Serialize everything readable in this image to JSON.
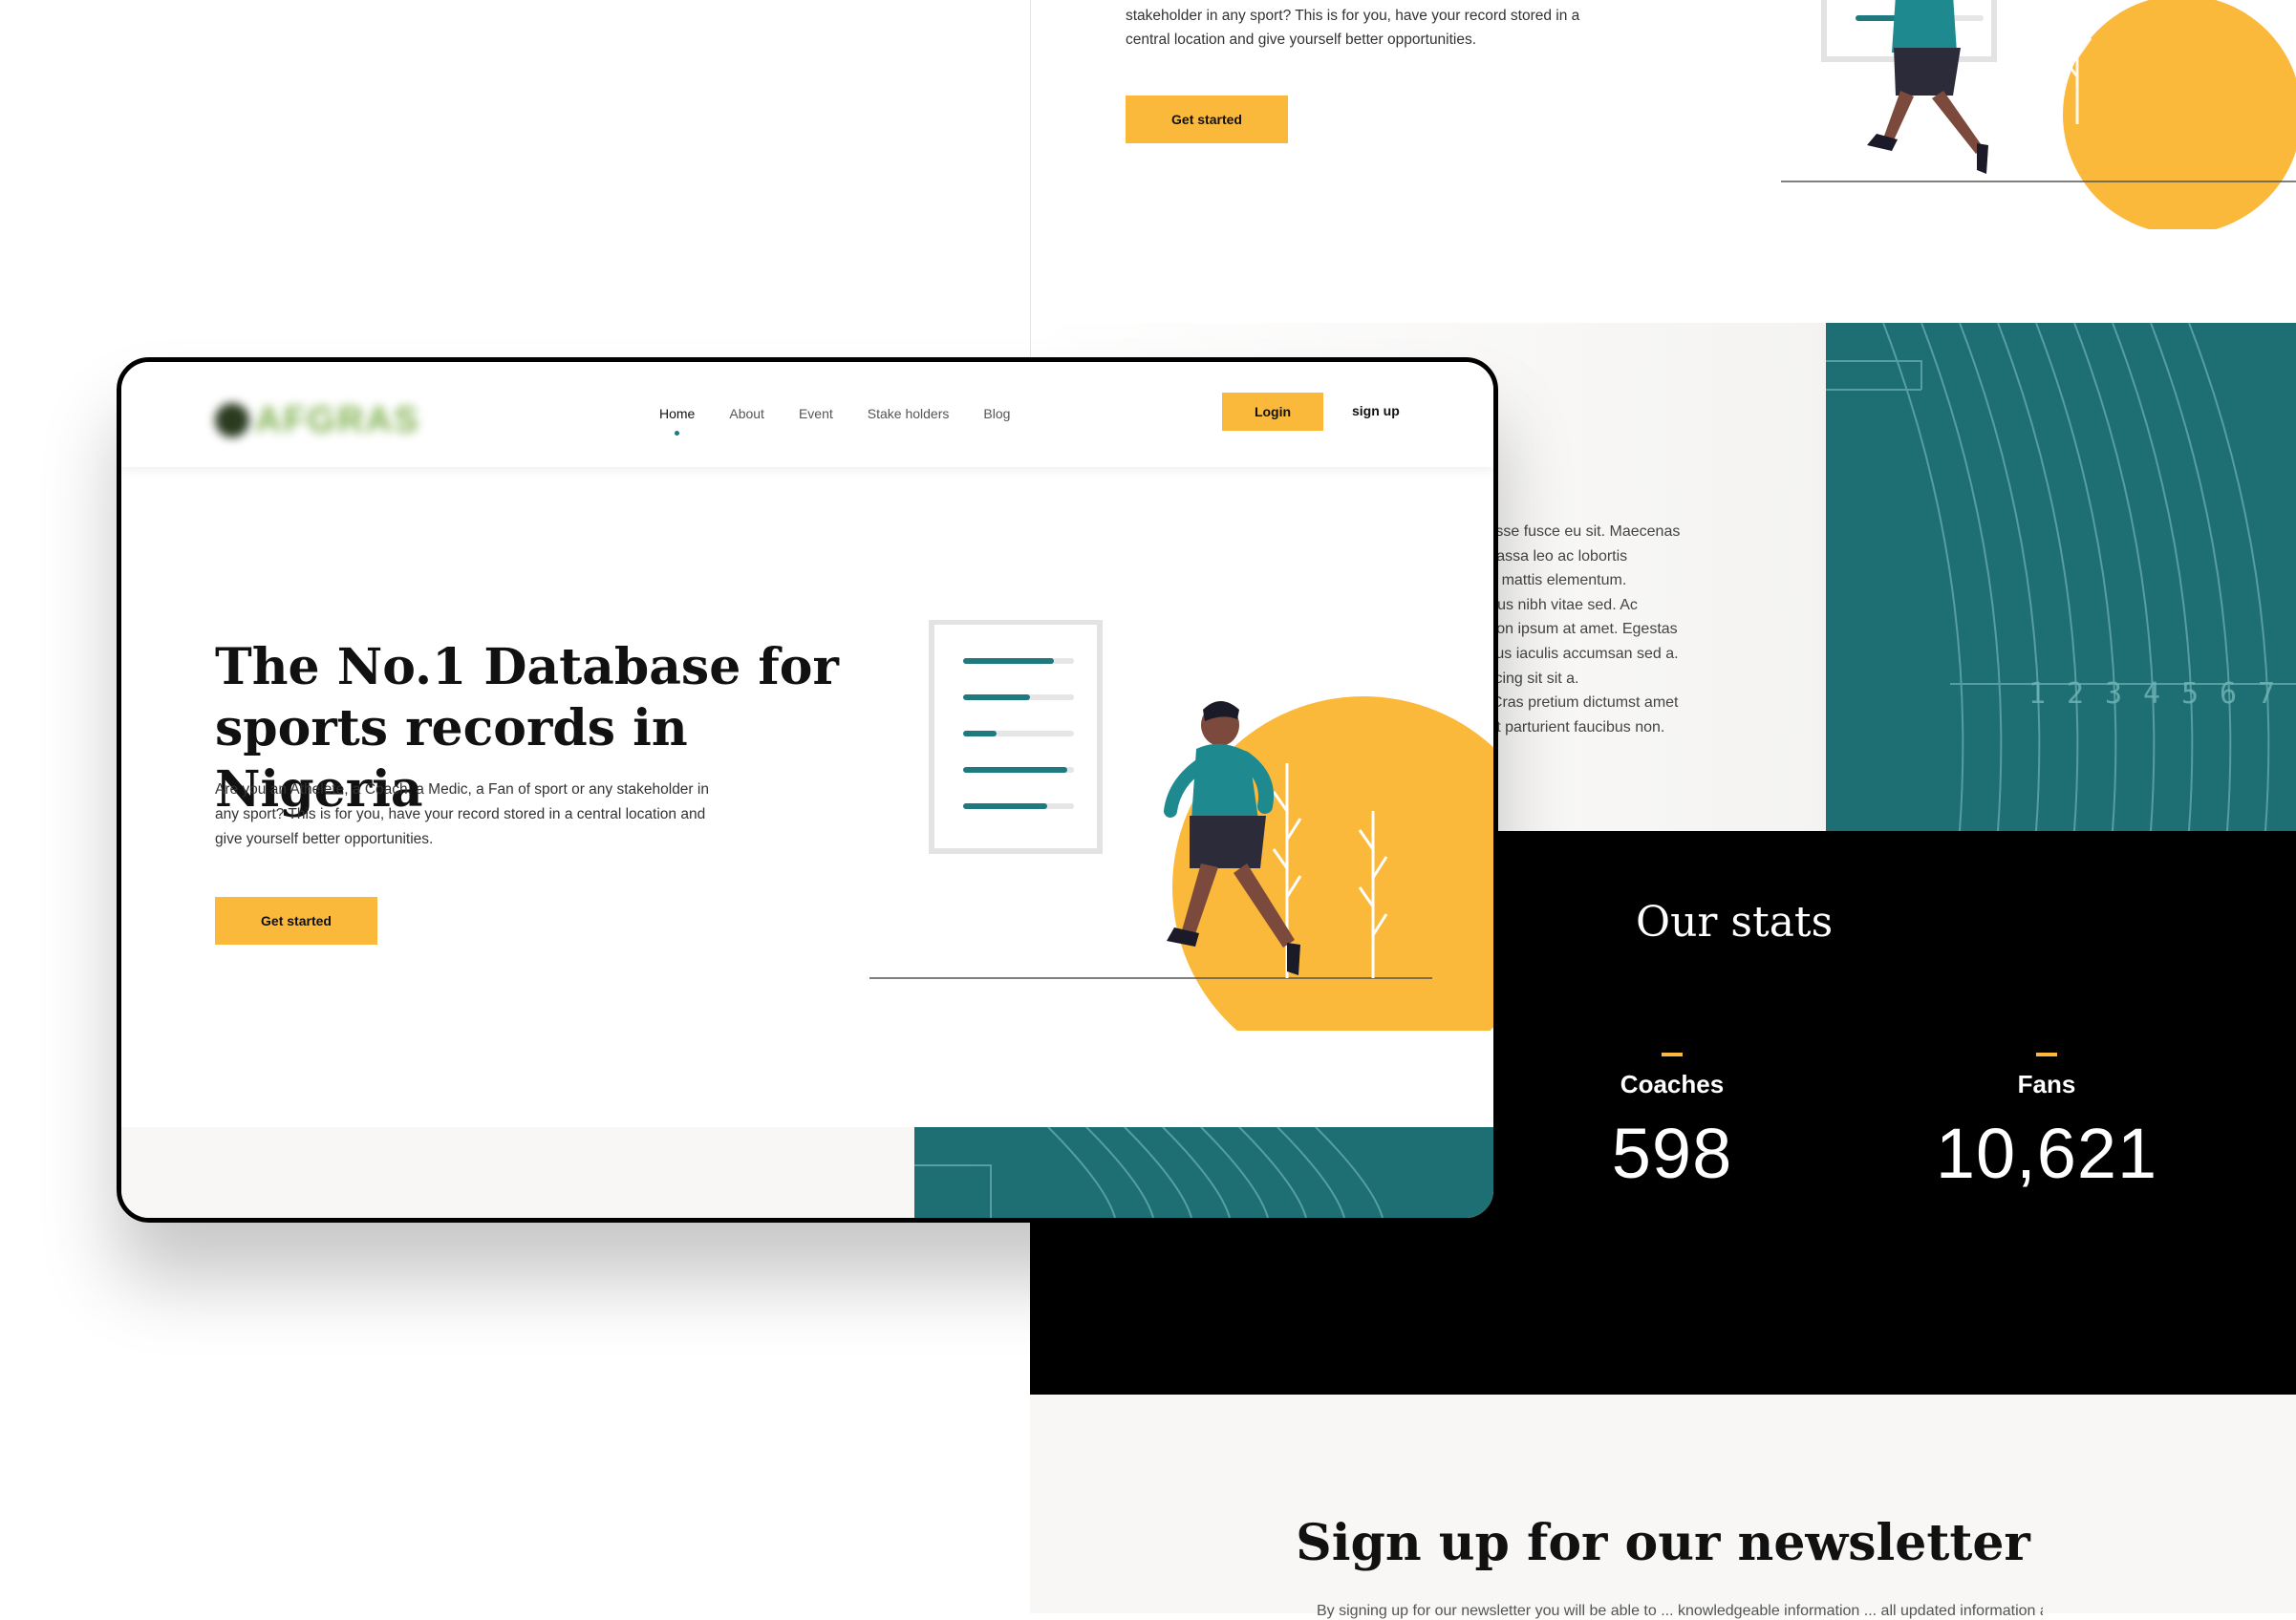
{
  "background_page": {
    "hero_text": "stakeholder in any sport? This is for you, have your record stored in a central location and give yourself better opportunities.",
    "get_started_label": "Get started",
    "about_lines": [
      "ndisse fusce eu sit. Maecenas",
      "t massa leo ac lobortis",
      "ere mattis elementum.",
      "purus nibh vitae sed. Ac",
      "n non ipsum at amet. Egestas",
      "ectus iaculis accumsan sed a.",
      "piscing sit sit a.",
      "s. Cras pretium dictumst amet",
      "n et parturient faucibus non."
    ],
    "track_lane_numbers": [
      "1",
      "2",
      "3",
      "4",
      "5",
      "6",
      "7"
    ],
    "stats": {
      "title": "Our stats",
      "items": [
        {
          "label": "Coaches",
          "value": "598"
        },
        {
          "label": "Fans",
          "value": "10,621"
        }
      ]
    },
    "newsletter": {
      "title": "Sign up for our newsletter",
      "subtitle": "By signing up for our newsletter you will be able to ... knowledgeable information ... all updated information about ..."
    }
  },
  "device": {
    "logo_text": "AFGRAS",
    "nav": [
      {
        "label": "Home",
        "active": true
      },
      {
        "label": "About",
        "active": false
      },
      {
        "label": "Event",
        "active": false
      },
      {
        "label": "Stake holders",
        "active": false
      },
      {
        "label": "Blog",
        "active": false
      }
    ],
    "login_label": "Login",
    "signup_label": "sign up",
    "hero": {
      "title": "The No.1 Database for sports records in Nigeria",
      "text": "Are you an Athelete, a Coach, a Medic, a Fan of sport or any stakeholder in any sport? This is for you, have your record stored in a central location and give yourself better opportunities.",
      "button_label": "Get started",
      "doc_progress": [
        0.82,
        0.6,
        0.3,
        0.94,
        0.76
      ]
    }
  },
  "colors": {
    "accent_yellow": "#fbb93c",
    "teal": "#1e7a7f",
    "track_teal": "#1e6f74",
    "stats_bg": "#000000"
  }
}
